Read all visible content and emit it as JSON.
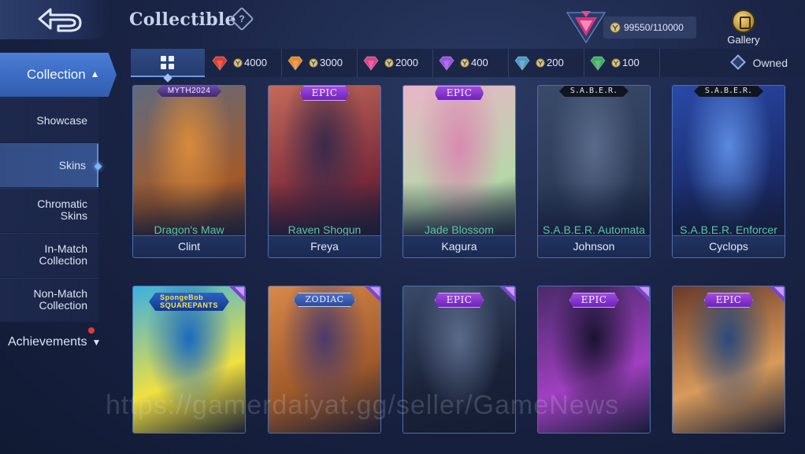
{
  "header": {
    "title": "Collectible",
    "help_glyph": "?",
    "currency": "99550/110000",
    "gallery_label": "Gallery"
  },
  "sidebar": {
    "collection_label": "Collection",
    "items": [
      {
        "label": "Showcase"
      },
      {
        "label": "Skins"
      },
      {
        "label": "Chromatic Skins"
      },
      {
        "label": "In-Match Collection"
      },
      {
        "label": "Non-Match Collection"
      }
    ],
    "achievements_label": "Achievements"
  },
  "filters": {
    "tiers": [
      {
        "value": "4000",
        "color": "#e23a2e"
      },
      {
        "value": "3000",
        "color": "#e88a2a"
      },
      {
        "value": "2000",
        "color": "#e0408a"
      },
      {
        "value": "400",
        "color": "#9c4fe8"
      },
      {
        "value": "200",
        "color": "#4a9cc2"
      },
      {
        "value": "100",
        "color": "#3fb060"
      }
    ],
    "owned_label": "Owned"
  },
  "cards": [
    {
      "badge": "MYTH2024",
      "skin": "Dragon's Maw",
      "hero": "Clint"
    },
    {
      "badge": "EPIC",
      "skin": "Raven Shogun",
      "hero": "Freya"
    },
    {
      "badge": "EPIC",
      "skin": "Jade Blossom",
      "hero": "Kagura"
    },
    {
      "badge": "S.A.B.E.R.",
      "skin": "S.A.B.E.R. Automata",
      "hero": "Johnson"
    },
    {
      "badge": "S.A.B.E.R.",
      "skin": "S.A.B.E.R. Enforcer",
      "hero": "Cyclops"
    },
    {
      "badge": "SpongeBob SQUAREPANTS"
    },
    {
      "badge": "ZODIAC"
    },
    {
      "badge": "EPIC"
    },
    {
      "badge": "EPIC"
    },
    {
      "badge": "EPIC"
    }
  ],
  "watermark": "https://gamerdaiyat.gg/seller/GameNews"
}
